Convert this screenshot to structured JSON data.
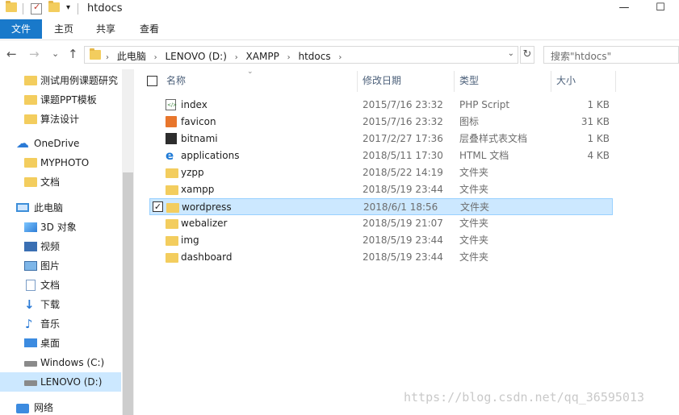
{
  "window": {
    "title": "htdocs",
    "minimize_glyph": "—",
    "maximize_glyph": "☐",
    "qat_dropdown_glyph": "▾"
  },
  "ribbon": {
    "tabs": [
      {
        "label": "文件"
      },
      {
        "label": "主页"
      },
      {
        "label": "共享"
      },
      {
        "label": "查看"
      }
    ]
  },
  "nav": {
    "back_glyph": "←",
    "forward_glyph": "→",
    "recent_glyph": "⌄",
    "up_glyph": "↑",
    "breadcrumbs": [
      "此电脑",
      "LENOVO (D:)",
      "XAMPP",
      "htdocs"
    ],
    "crumb_sep": "›",
    "refresh_glyph": "↻",
    "search_placeholder": "搜索\"htdocs\""
  },
  "sidebar": {
    "items": [
      {
        "label": "测试用例课题研究",
        "icon": "folder-icon",
        "indent": 1
      },
      {
        "label": "课题PPT模板",
        "icon": "folder-icon",
        "indent": 1
      },
      {
        "label": "算法设计",
        "icon": "folder-icon",
        "indent": 1
      },
      {
        "label": "OneDrive",
        "icon": "onedrive-icon",
        "indent": 0
      },
      {
        "label": "MYPHOTO",
        "icon": "folder-icon",
        "indent": 1
      },
      {
        "label": "文档",
        "icon": "folder-icon",
        "indent": 1
      },
      {
        "label": "此电脑",
        "icon": "computer-icon",
        "indent": 0
      },
      {
        "label": "3D 对象",
        "icon": "3d-objects-icon",
        "indent": 1
      },
      {
        "label": "视频",
        "icon": "videos-icon",
        "indent": 1
      },
      {
        "label": "图片",
        "icon": "pictures-icon",
        "indent": 1
      },
      {
        "label": "文档",
        "icon": "documents-icon",
        "indent": 1
      },
      {
        "label": "下载",
        "icon": "downloads-icon",
        "indent": 1
      },
      {
        "label": "音乐",
        "icon": "music-icon",
        "indent": 1
      },
      {
        "label": "桌面",
        "icon": "desktop-icon",
        "indent": 1
      },
      {
        "label": "Windows (C:)",
        "icon": "drive-icon",
        "indent": 1
      },
      {
        "label": "LENOVO (D:)",
        "icon": "drive-icon",
        "indent": 1,
        "selected": true
      },
      {
        "label": "网络",
        "icon": "network-icon",
        "indent": 0
      }
    ]
  },
  "columns": {
    "name": "名称",
    "date": "修改日期",
    "type": "类型",
    "size": "大小",
    "sort_glyph": "⌄"
  },
  "files": [
    {
      "name": "index",
      "date": "2015/7/16 23:32",
      "type": "PHP Script",
      "size": "1 KB",
      "icon": "php-file-icon"
    },
    {
      "name": "favicon",
      "date": "2015/7/16 23:32",
      "type": "图标",
      "size": "31 KB",
      "icon": "xampp-icon"
    },
    {
      "name": "bitnami",
      "date": "2017/2/27 17:36",
      "type": "层叠样式表文档",
      "size": "1 KB",
      "icon": "css-file-icon"
    },
    {
      "name": "applications",
      "date": "2018/5/11 17:30",
      "type": "HTML 文档",
      "size": "4 KB",
      "icon": "ie-icon"
    },
    {
      "name": "yzpp",
      "date": "2018/5/22 14:19",
      "type": "文件夹",
      "size": "",
      "icon": "folder-icon"
    },
    {
      "name": "xampp",
      "date": "2018/5/19 23:44",
      "type": "文件夹",
      "size": "",
      "icon": "folder-icon"
    },
    {
      "name": "wordpress",
      "date": "2018/6/1 18:56",
      "type": "文件夹",
      "size": "",
      "icon": "folder-icon",
      "selected": true
    },
    {
      "name": "webalizer",
      "date": "2018/5/19 21:07",
      "type": "文件夹",
      "size": "",
      "icon": "folder-icon"
    },
    {
      "name": "img",
      "date": "2018/5/19 23:44",
      "type": "文件夹",
      "size": "",
      "icon": "folder-icon"
    },
    {
      "name": "dashboard",
      "date": "2018/5/19 23:44",
      "type": "文件夹",
      "size": "",
      "icon": "folder-icon"
    }
  ],
  "watermark": "https://blog.csdn.net/qq_36595013",
  "colors": {
    "accent": "#1979ca",
    "selection": "#cce8ff",
    "selection_border": "#99d1ff",
    "folder": "#f3cd5e"
  }
}
